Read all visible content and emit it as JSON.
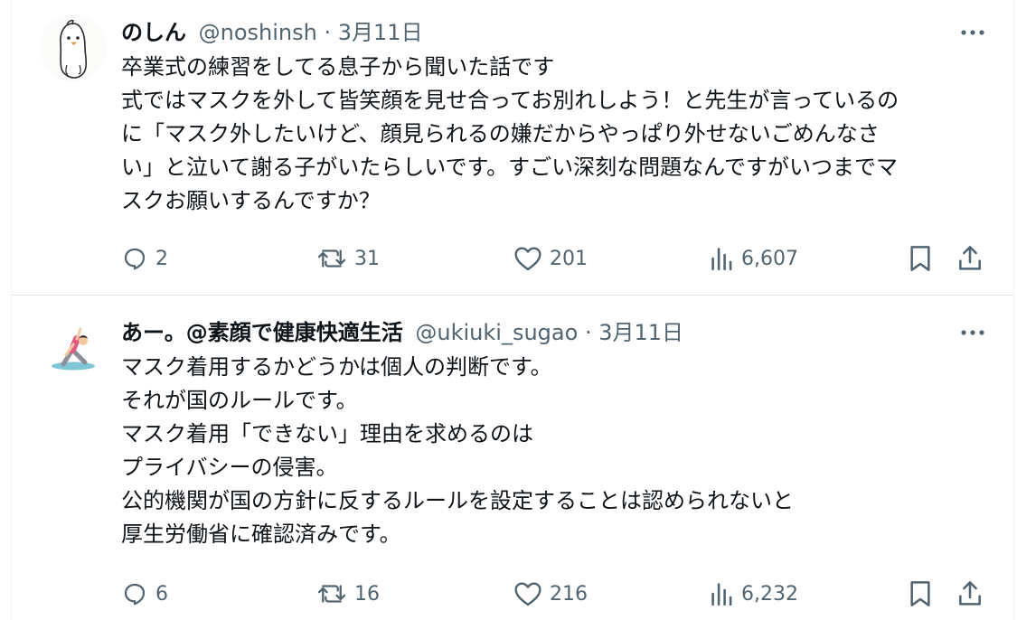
{
  "tweets": [
    {
      "name": "のしん",
      "handle": "@noshinsh",
      "separator": "·",
      "date": "3月11日",
      "avatar_icon": "bird-avatar-icon",
      "lines": [
        "卒業式の練習をしてる息子から聞いた話です",
        "式ではマスクを外して皆笑顔を見せ合ってお別れしよう！と先生が言っているの",
        "に「マスク外したいけど、顔見られるの嫌だからやっぱり外せないごめんなさ",
        "い」と泣いて謝る子がいたらしいです。すごい深刻な問題なんですがいつまでマ",
        "スクお願いするんですか？"
      ],
      "replies": "2",
      "retweets": "31",
      "likes": "201",
      "views": "6,607"
    },
    {
      "name": "あー。@素顔で健康快適生活",
      "handle": "@ukiuki_sugao",
      "separator": "·",
      "date": "3月11日",
      "avatar_icon": "yoga-person-avatar-icon",
      "lines": [
        "マスク着用するかどうかは個人の判断です。",
        "それが国のルールです。",
        "マスク着用「できない」理由を求めるのは",
        "プライバシーの侵害。",
        "公的機関が国の方針に反するルールを設定することは認められないと",
        "厚生労働省に確認済みです。"
      ],
      "replies": "6",
      "retweets": "16",
      "likes": "216",
      "views": "6,232"
    }
  ],
  "colors": {
    "text": "#0f1419",
    "secondary": "#536471",
    "divider": "#e3e7ea"
  }
}
